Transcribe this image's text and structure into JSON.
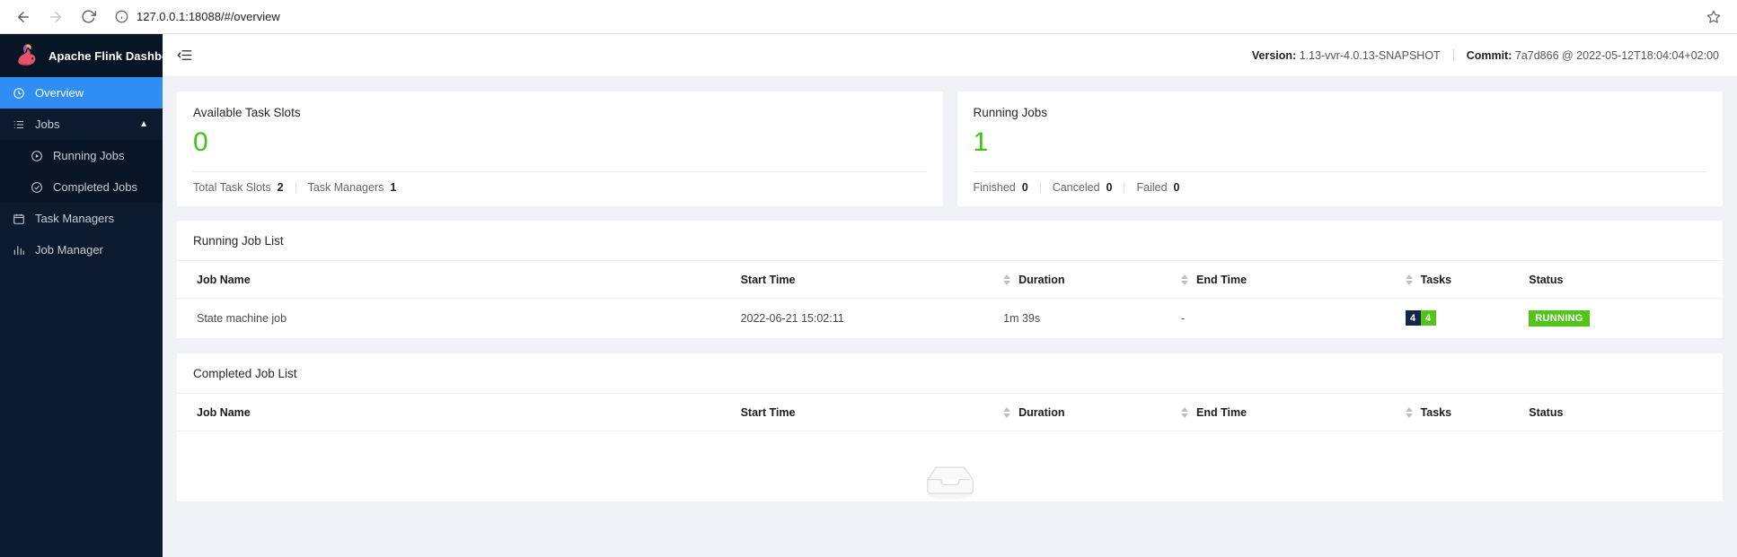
{
  "browser": {
    "url": "127.0.0.1:18088/#/overview",
    "back_icon": "back-arrow-icon",
    "forward_icon": "forward-arrow-icon",
    "reload_icon": "reload-icon",
    "info_icon": "info-circle-icon",
    "star_icon": "bookmark-star-icon"
  },
  "sidebar": {
    "brand": "Apache Flink Dashboard",
    "items": [
      {
        "label": "Overview",
        "icon": "dashboard-icon",
        "active": true,
        "level": 1
      },
      {
        "label": "Jobs",
        "icon": "list-icon",
        "active": false,
        "level": 1,
        "expanded": true
      },
      {
        "label": "Running Jobs",
        "icon": "play-circle-icon",
        "active": false,
        "level": 2
      },
      {
        "label": "Completed Jobs",
        "icon": "check-circle-icon",
        "active": false,
        "level": 2
      },
      {
        "label": "Task Managers",
        "icon": "calendar-icon",
        "active": false,
        "level": 1
      },
      {
        "label": "Job Manager",
        "icon": "chart-icon",
        "active": false,
        "level": 1
      }
    ]
  },
  "topbar": {
    "collapse_icon": "menu-collapse-icon",
    "version_label": "Version:",
    "version_value": "1.13-vvr-4.0.13-SNAPSHOT",
    "commit_label": "Commit:",
    "commit_value": "7a7d866 @ 2022-05-12T18:04:04+02:00"
  },
  "cards": {
    "task_slots": {
      "title": "Available Task Slots",
      "value": "0",
      "footer": [
        {
          "label": "Total Task Slots",
          "value": "2"
        },
        {
          "label": "Task Managers",
          "value": "1"
        }
      ]
    },
    "running_jobs": {
      "title": "Running Jobs",
      "value": "1",
      "footer": [
        {
          "label": "Finished",
          "value": "0"
        },
        {
          "label": "Canceled",
          "value": "0"
        },
        {
          "label": "Failed",
          "value": "0"
        }
      ]
    }
  },
  "running_job_list": {
    "title": "Running Job List",
    "columns": [
      {
        "label": "Job Name",
        "sortable": false
      },
      {
        "label": "Start Time",
        "sortable": true
      },
      {
        "label": "Duration",
        "sortable": true
      },
      {
        "label": "End Time",
        "sortable": true
      },
      {
        "label": "Tasks",
        "sortable": false
      },
      {
        "label": "Status",
        "sortable": false
      }
    ],
    "rows": [
      {
        "job_name": "State machine job",
        "start_time": "2022-06-21 15:02:11",
        "duration": "1m 39s",
        "end_time": "-",
        "tasks_total": "4",
        "tasks_running": "4",
        "status": "RUNNING"
      }
    ]
  },
  "completed_job_list": {
    "title": "Completed Job List",
    "columns": [
      {
        "label": "Job Name",
        "sortable": false
      },
      {
        "label": "Start Time",
        "sortable": true
      },
      {
        "label": "Duration",
        "sortable": true
      },
      {
        "label": "End Time",
        "sortable": true
      },
      {
        "label": "Tasks",
        "sortable": false
      },
      {
        "label": "Status",
        "sortable": false
      }
    ],
    "rows": [],
    "empty_icon": "empty-inbox-icon"
  },
  "colors": {
    "accent_blue": "#2f8ef4",
    "sidebar_bg": "#0b1b2d",
    "green": "#52c41a",
    "stat_green": "#3bc417",
    "tasks_dark": "#12274a"
  }
}
